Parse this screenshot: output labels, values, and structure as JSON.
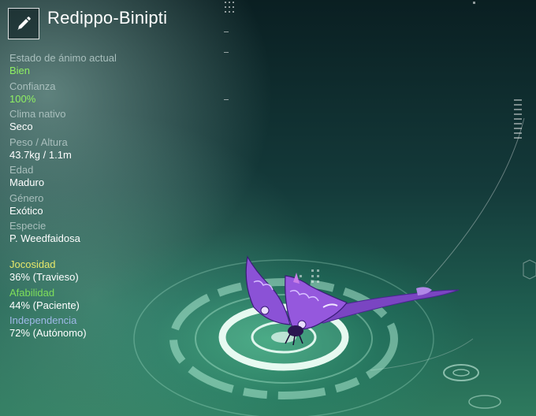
{
  "header": {
    "name": "Redippo-Binipti",
    "edit_icon": "pencil-icon"
  },
  "stats": [
    {
      "label": "Estado de ánimo actual",
      "value": "Bien",
      "value_color": "#8ff063"
    },
    {
      "label": "Confianza",
      "value": "100%",
      "value_color": "#8ff063"
    },
    {
      "label": "Clima nativo",
      "value": "Seco",
      "value_color": "#ffffff"
    },
    {
      "label": "Peso / Altura",
      "value": "43.7kg / 1.1m",
      "value_color": "#ffffff"
    },
    {
      "label": "Edad",
      "value": "Maduro",
      "value_color": "#ffffff"
    },
    {
      "label": "Género",
      "value": "Exótico",
      "value_color": "#ffffff"
    },
    {
      "label": "Especie",
      "value": "P. Weedfaidosa",
      "value_color": "#ffffff"
    }
  ],
  "traits": [
    {
      "label": "Jocosidad",
      "value": "36% (Travieso)",
      "label_color": "#e8e86a",
      "level": 0.36
    },
    {
      "label": "Afabilidad",
      "value": "44% (Paciente)",
      "label_color": "#7fdf5a",
      "level": 0.44
    },
    {
      "label": "Independencia",
      "value": "72% (Autónomo)",
      "label_color": "#9fb8e8",
      "level": 0.72
    }
  ],
  "creature": {
    "icon": "butterfly-creature-icon",
    "colors": {
      "wing_primary": "#8a4fd0",
      "wing_dark": "#5a2a9a",
      "wing_accent": "#c9a6ff"
    }
  },
  "theme": {
    "accent_green": "#8ff063",
    "label_grey": "#a9bfbd",
    "pedestal_ring": "#e6fff4"
  }
}
